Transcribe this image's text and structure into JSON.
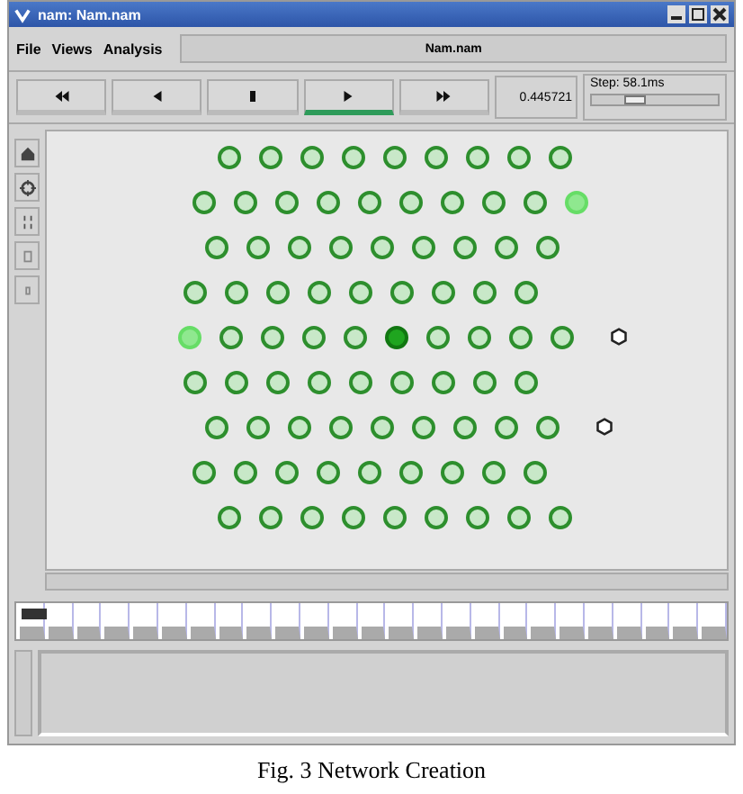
{
  "window": {
    "title": "nam: Nam.nam"
  },
  "menu": [
    "File",
    "Views",
    "Analysis"
  ],
  "file_field": {
    "value": "Nam.nam"
  },
  "controls": [
    {
      "kind": "rewind",
      "selected": false
    },
    {
      "kind": "back",
      "selected": false
    },
    {
      "kind": "stop",
      "selected": false
    },
    {
      "kind": "play",
      "selected": true
    },
    {
      "kind": "forward",
      "selected": false
    }
  ],
  "time": "0.445721",
  "step": {
    "label": "Step: 58.1ms",
    "level": 0.3
  },
  "tools": [
    {
      "kind": "select"
    },
    {
      "kind": "move"
    },
    {
      "kind": "link"
    },
    {
      "kind": "zoom-in"
    },
    {
      "kind": "zoom-out"
    }
  ],
  "node_rows": [
    {
      "nodes": [
        {
          "kind": "normal"
        },
        {
          "kind": "normal"
        },
        {
          "kind": "normal"
        },
        {
          "kind": "normal"
        },
        {
          "kind": "normal"
        },
        {
          "kind": "normal"
        },
        {
          "kind": "normal"
        },
        {
          "kind": "normal"
        },
        {
          "kind": "normal"
        }
      ]
    },
    {
      "nodes": [
        {
          "kind": "normal"
        },
        {
          "kind": "normal"
        },
        {
          "kind": "normal"
        },
        {
          "kind": "normal"
        },
        {
          "kind": "normal"
        },
        {
          "kind": "normal"
        },
        {
          "kind": "normal"
        },
        {
          "kind": "normal"
        },
        {
          "kind": "normal"
        },
        {
          "kind": "highlight"
        }
      ]
    },
    {
      "nodes": [
        {
          "kind": "normal"
        },
        {
          "kind": "normal"
        },
        {
          "kind": "normal"
        },
        {
          "kind": "normal"
        },
        {
          "kind": "normal"
        },
        {
          "kind": "normal"
        },
        {
          "kind": "normal"
        },
        {
          "kind": "normal"
        },
        {
          "kind": "normal"
        }
      ]
    },
    {
      "nodes": [
        {
          "kind": "normal"
        },
        {
          "kind": "normal"
        },
        {
          "kind": "normal"
        },
        {
          "kind": "normal"
        },
        {
          "kind": "normal"
        },
        {
          "kind": "normal"
        },
        {
          "kind": "normal"
        },
        {
          "kind": "normal"
        },
        {
          "kind": "normal"
        }
      ]
    },
    {
      "nodes": [
        {
          "kind": "highlight"
        },
        {
          "kind": "normal"
        },
        {
          "kind": "normal"
        },
        {
          "kind": "normal"
        },
        {
          "kind": "normal"
        },
        {
          "kind": "active"
        },
        {
          "kind": "normal"
        },
        {
          "kind": "normal"
        },
        {
          "kind": "normal"
        },
        {
          "kind": "normal"
        },
        {
          "kind": "agent"
        }
      ]
    },
    {
      "nodes": [
        {
          "kind": "normal"
        },
        {
          "kind": "normal"
        },
        {
          "kind": "normal"
        },
        {
          "kind": "normal"
        },
        {
          "kind": "normal"
        },
        {
          "kind": "normal"
        },
        {
          "kind": "normal"
        },
        {
          "kind": "normal"
        },
        {
          "kind": "normal"
        }
      ]
    },
    {
      "nodes": [
        {
          "kind": "normal"
        },
        {
          "kind": "normal"
        },
        {
          "kind": "normal"
        },
        {
          "kind": "normal"
        },
        {
          "kind": "normal"
        },
        {
          "kind": "normal"
        },
        {
          "kind": "normal"
        },
        {
          "kind": "normal"
        },
        {
          "kind": "normal"
        },
        {
          "kind": "agent"
        }
      ]
    },
    {
      "nodes": [
        {
          "kind": "normal"
        },
        {
          "kind": "normal"
        },
        {
          "kind": "normal"
        },
        {
          "kind": "normal"
        },
        {
          "kind": "normal"
        },
        {
          "kind": "normal"
        },
        {
          "kind": "normal"
        },
        {
          "kind": "normal"
        },
        {
          "kind": "normal"
        }
      ]
    },
    {
      "nodes": [
        {
          "kind": "normal"
        },
        {
          "kind": "normal"
        },
        {
          "kind": "normal"
        },
        {
          "kind": "normal"
        },
        {
          "kind": "normal"
        },
        {
          "kind": "normal"
        },
        {
          "kind": "normal"
        },
        {
          "kind": "normal"
        },
        {
          "kind": "normal"
        }
      ]
    }
  ],
  "caption": "Fig. 3 Network Creation"
}
